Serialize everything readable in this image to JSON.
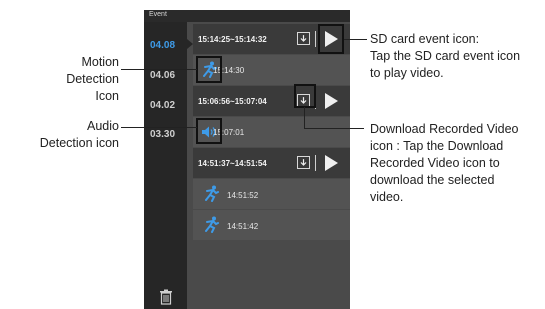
{
  "screen": {
    "title": "Event",
    "dates": [
      "04.08",
      "04.06",
      "04.02",
      "03.30"
    ],
    "active_date": "04.08",
    "rows": [
      {
        "kind": "sd",
        "text": "15:14:25~15:14:32"
      },
      {
        "kind": "motion",
        "text": "15:14:30"
      },
      {
        "kind": "sd",
        "text": "15:06:56~15:07:04"
      },
      {
        "kind": "audio",
        "text": "15:07:01"
      },
      {
        "kind": "sd",
        "text": "14:51:37~14:51:54"
      },
      {
        "kind": "motion",
        "text": "14:51:52"
      },
      {
        "kind": "motion",
        "text": "14:51:42"
      }
    ],
    "accent_color": "#3e9be8"
  },
  "callouts": {
    "motion": [
      "Motion Detection",
      "Icon"
    ],
    "audio": [
      "Audio",
      "Detection icon"
    ],
    "sd": [
      "SD card event icon:",
      "Tap the SD card event icon",
      "to play video."
    ],
    "download": [
      "Download Recorded Video",
      "icon : Tap the Download",
      "Recorded Video icon to",
      "download the selected",
      "video."
    ]
  }
}
